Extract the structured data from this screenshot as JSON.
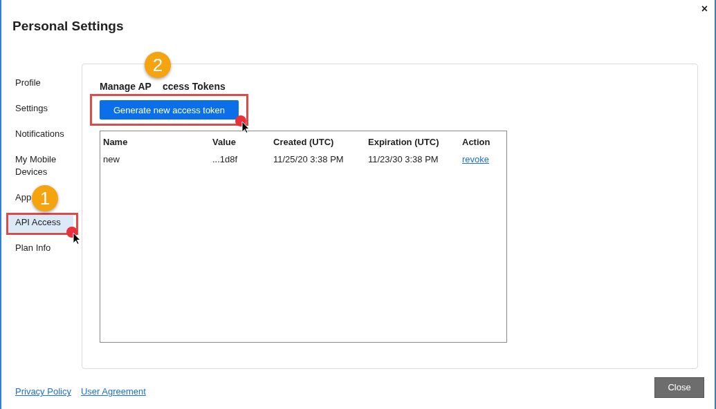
{
  "dialog": {
    "title": "Personal Settings",
    "close_glyph": "×"
  },
  "sidebar": {
    "items": [
      {
        "label": "Profile",
        "selected": false
      },
      {
        "label": "Settings",
        "selected": false
      },
      {
        "label": "Notifications",
        "selected": false
      },
      {
        "label": "My Mobile Devices",
        "selected": false
      },
      {
        "label": "App",
        "selected": false
      },
      {
        "label": "API Access",
        "selected": true
      },
      {
        "label": "Plan Info",
        "selected": false
      }
    ]
  },
  "panel": {
    "heading_parts": [
      "Manage AP",
      "ccess Tokens"
    ],
    "generate_button": "Generate new access token",
    "table": {
      "columns": [
        "Name",
        "Value",
        "Created (UTC)",
        "Expiration (UTC)",
        "Action"
      ],
      "rows": [
        {
          "name": "new",
          "value": "...1d8f",
          "created": "11/25/20 3:38 PM",
          "expiration": "11/23/30 3:38 PM",
          "action": "revoke"
        }
      ]
    }
  },
  "footer": {
    "links": [
      "Privacy Policy",
      "User Agreement"
    ],
    "close_button": "Close"
  },
  "callouts": [
    {
      "label": "1"
    },
    {
      "label": "2"
    }
  ]
}
